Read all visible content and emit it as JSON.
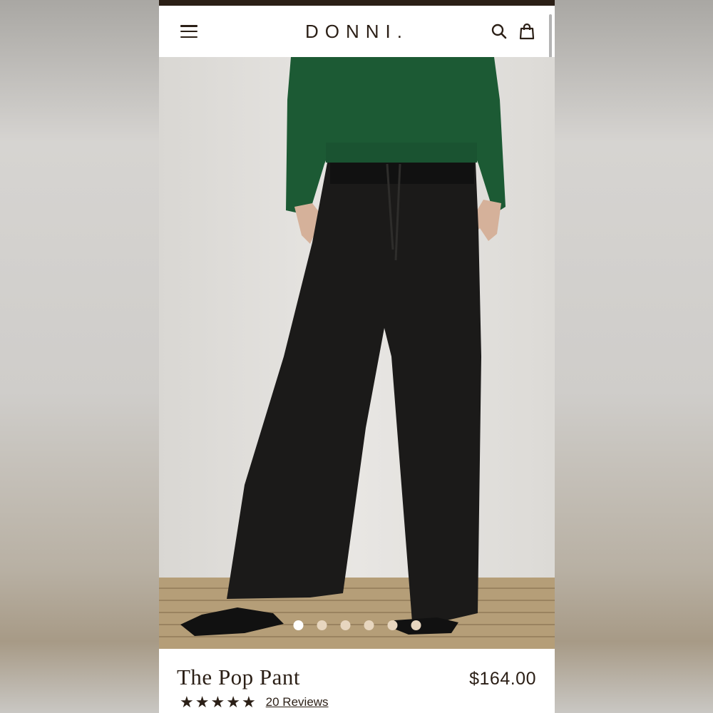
{
  "header": {
    "logo": "DONNI.",
    "menu_icon": "hamburger-menu-icon",
    "search_icon": "search-icon",
    "cart_icon": "shopping-bag-icon"
  },
  "gallery": {
    "image_description": "model wearing black wide-leg pull-on pants and green ribbed long-sleeve top, standing on a woven jute rug",
    "dots": [
      {
        "active": true
      },
      {
        "active": false
      },
      {
        "active": false
      },
      {
        "active": false
      },
      {
        "active": false
      },
      {
        "active": false
      }
    ]
  },
  "product": {
    "title": "The Pop Pant",
    "price": "$164.00",
    "rating_stars": 5,
    "reviews_label": "20 Reviews"
  },
  "colors": {
    "brand_dark": "#2b1f16",
    "dot_inactive": "#e7d6bf",
    "dot_active": "#ffffff"
  }
}
